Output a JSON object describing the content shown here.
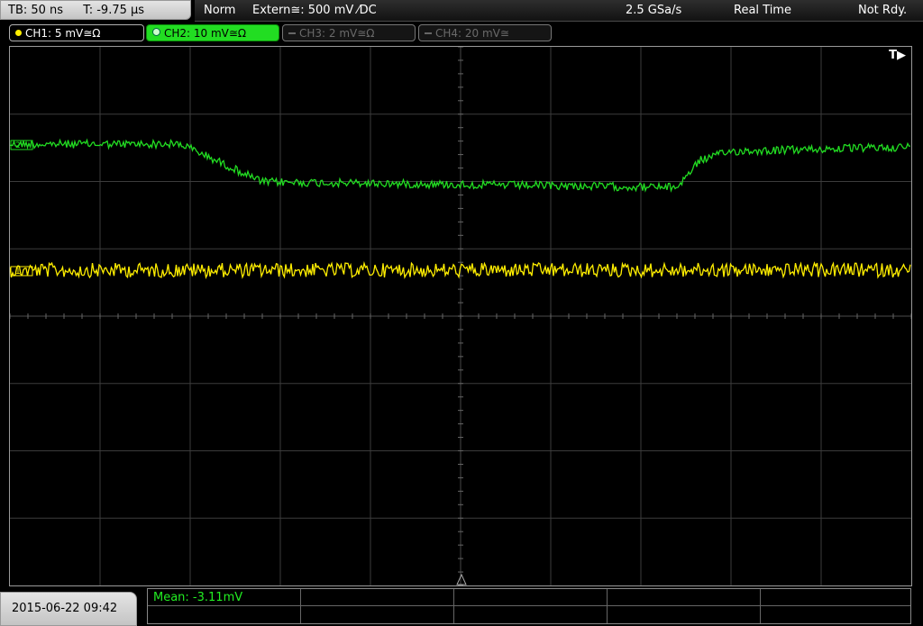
{
  "header": {
    "timebase": "TB: 50 ns",
    "trigger_time": "T: -9.75 µs",
    "trigger_mode": "Norm",
    "trigger_source": "Extern≅: 500 mV ⁄DC",
    "sample_rate": "2.5 GSa/s",
    "acq_mode": "Real Time",
    "status": "Not Rdy."
  },
  "channels": [
    {
      "label": "CH1: 5 mV≅Ω",
      "color": "#ffee00",
      "active": true
    },
    {
      "label": "CH2: 10 mV≅Ω",
      "color": "#22dd22",
      "active": true,
      "selected": true
    },
    {
      "label": "CH3: 2 mV≅Ω",
      "color": "#666666",
      "active": false
    },
    {
      "label": "CH4: 20 mV≅",
      "color": "#666666",
      "active": false
    }
  ],
  "screen": {
    "trigger_indicator": "T▶",
    "ch1_marker": "1",
    "ch2_marker": "2"
  },
  "footer": {
    "datetime": "2015-06-22 09:42",
    "measurement": "Mean: -3.11mV"
  },
  "colors": {
    "ch1": "#ffee00",
    "ch2": "#22dd22",
    "grid": "#3c3c3c"
  }
}
